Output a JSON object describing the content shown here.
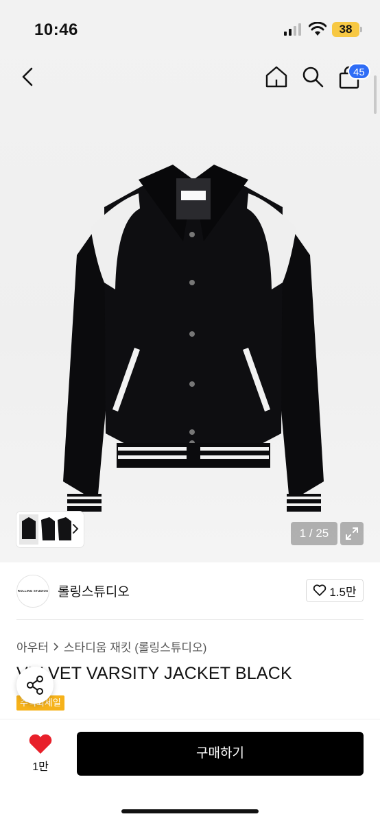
{
  "status_bar": {
    "time": "10:46",
    "battery": "38"
  },
  "nav": {
    "cart_count": "45",
    "icons": [
      "back-icon",
      "home-icon",
      "search-icon",
      "cart-icon"
    ]
  },
  "gallery": {
    "counter": "1 / 25"
  },
  "brand": {
    "logo_text": "ROLLING STUDIOS",
    "name": "롤링스튜디오",
    "likes": "1.5만"
  },
  "breadcrumb": {
    "category": "아우터",
    "subcategory": "스타디움 재킷 (롤링스튜디오)"
  },
  "product": {
    "title": "VELVET VARSITY JACKET BLACK",
    "sale_badge": "주식회세일"
  },
  "bottom_bar": {
    "likes": "1만",
    "buy_label": "구매하기"
  },
  "colors": {
    "accent": "#2f6df6",
    "buy_button": "#000000",
    "heart": "#e8202a",
    "sale_badge": "#f6b21a",
    "battery": "#f7c843"
  }
}
